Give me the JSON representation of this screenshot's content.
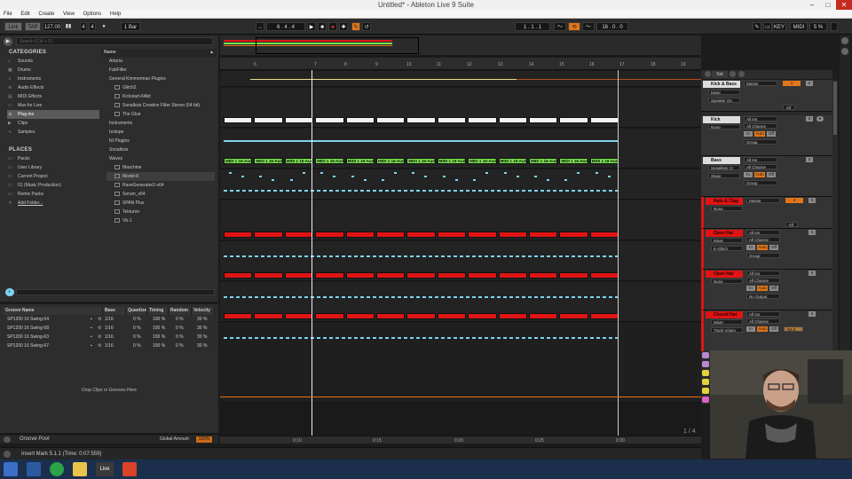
{
  "window": {
    "title": "Untitled* - Ableton Live 9 Suite"
  },
  "menu": [
    "File",
    "Edit",
    "Create",
    "View",
    "Options",
    "Help"
  ],
  "control": {
    "link": "Link",
    "tap": "TAP",
    "tempo": "127.00",
    "sig_num": "4",
    "sig_den": "4",
    "quant": "1 Bar",
    "pos": "6 . 4 . 4",
    "loop_start": "1 . 1 . 1",
    "loop_len": "16 . 0 . 0",
    "key": "KEY",
    "midi": "MIDI",
    "cpu": "5 %"
  },
  "browser": {
    "search_placeholder": "Search (Ctrl + F)",
    "categories_title": "CATEGORIES",
    "categories": [
      "Sounds",
      "Drums",
      "Instruments",
      "Audio Effects",
      "MIDI Effects",
      "Max for Live",
      "Plug-ins",
      "Clips",
      "Samples"
    ],
    "places_title": "PLACES",
    "places": [
      "Packs",
      "User Library",
      "Current Project",
      "01 (Music Production)",
      "Remix Packs",
      "Add Folder..."
    ],
    "list_header": "Name",
    "items": [
      "Arturia",
      "FabFilter",
      "General Kimmerman Plugins",
      "Glitch2",
      "Kickstart-64bit",
      "Sonalksis Creative Filter Stereo (64 bit)",
      "The Glue",
      "Instruments",
      "Izotope",
      "NI Plugins",
      "Sonalksis",
      "Waves",
      "Maschine",
      "Model-8",
      "RaveGenerator2-x64",
      "Serum_x64",
      "SPAN Plus",
      "Tekturon",
      "Vb-1"
    ]
  },
  "groove": {
    "headers": [
      "Groove Name",
      "Base",
      "Quantize",
      "Timing",
      "Random",
      "Velocity"
    ],
    "rows": [
      [
        "SP1200 16 Swing-54",
        "1/16",
        "0 %",
        "100 %",
        "0 %",
        "30 %"
      ],
      [
        "SP1200 16 Swing-58",
        "1/16",
        "0 %",
        "100 %",
        "0 %",
        "30 %"
      ],
      [
        "SP1200 16 Swing-63",
        "1/16",
        "0 %",
        "100 %",
        "0 %",
        "30 %"
      ],
      [
        "SP1200 16 Swing-67",
        "1/16",
        "0 %",
        "100 %",
        "0 %",
        "30 %"
      ]
    ],
    "drop_text": "Drop Clips or Grooves Here",
    "pool_label": "Groove Pool",
    "global_amount_label": "Global Amount",
    "global_amount": "100%"
  },
  "arrangement": {
    "bar_numbers": [
      "6",
      "7",
      "8",
      "9",
      "10",
      "11",
      "12",
      "13",
      "14",
      "15",
      "16",
      "17",
      "18",
      "19"
    ],
    "time_labels": [
      "0:10",
      "0:15",
      "0:20",
      "0:25",
      "0:30"
    ],
    "midi_clip_label": "MIDI 1 16-Aud",
    "page": "1 / 4",
    "set_label": "Set"
  },
  "mixer": {
    "tracks": [
      {
        "name": "Kick & Bass",
        "out": "Master",
        "dev": "Mixer",
        "param": "Speaker On",
        "vol": "-inf",
        "color": "#dddddd"
      },
      {
        "name": "Kick",
        "in": "All Ins",
        "ch": "All Channe",
        "dev": "None",
        "mon": [
          "In",
          "Auto",
          "Off"
        ],
        "group": "Group",
        "color": "#dddddd"
      },
      {
        "name": "Bass",
        "in": "All Ins",
        "ch": "All Channe",
        "dev": "Sonalksis Cr",
        "param": "Slope",
        "mon": [
          "In",
          "Auto",
          "Off"
        ],
        "group": "Group",
        "color": "#dddddd"
      },
      {
        "name": "Hats & Clap",
        "out": "Master",
        "dev": "None",
        "vol": "-inf",
        "color": "#e01414"
      },
      {
        "name": "Open Hat",
        "in": "All Ins",
        "ch": "All Channe",
        "dev": "Mixer",
        "param": "E-Glitch",
        "mon": [
          "In",
          "Auto",
          "Off"
        ],
        "group": "Group",
        "color": "#e01414"
      },
      {
        "name": "Open Hat",
        "in": "All Ins",
        "ch": "All Channe",
        "dev": "None",
        "mon": [
          "In",
          "Auto",
          "Off"
        ],
        "out": "No Output",
        "color": "#e01414"
      },
      {
        "name": "Closed Hat",
        "in": "All Ins",
        "ch": "All Channe",
        "dev": "Mixer",
        "param": "Track Volum",
        "mon": [
          "In",
          "Auto",
          "Off"
        ],
        "vol": "-54.0",
        "color": "#e01414"
      }
    ]
  },
  "status": {
    "text": "Insert Mark 5.1.1 (Time: 0:07:559)"
  },
  "taskbar": {
    "live_label": "Live"
  },
  "colors": {
    "orange": "#e0751a",
    "green": "#79e24d",
    "red": "#e01414",
    "cyan": "#7dd3f0",
    "white": "#f2f2f2"
  }
}
